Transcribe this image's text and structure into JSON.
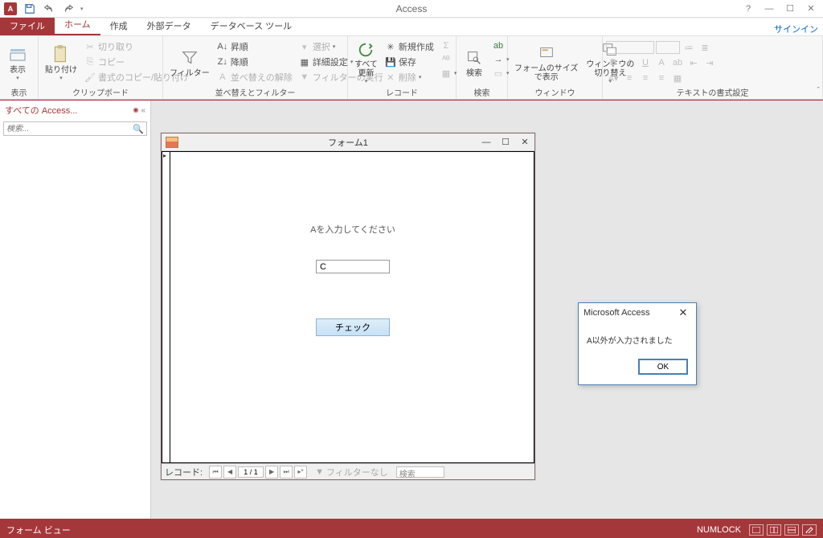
{
  "app": {
    "title": "Access",
    "signin": "サインイン"
  },
  "tabs": {
    "file": "ファイル",
    "home": "ホーム",
    "create": "作成",
    "external": "外部データ",
    "dbtools": "データベース ツール"
  },
  "ribbon": {
    "view": "表示",
    "paste": "貼り付け",
    "cut": "切り取り",
    "copy": "コピー",
    "format_painter": "書式のコピー/貼り付け",
    "clipboard_label": "クリップボード",
    "filter": "フィルター",
    "asc": "昇順",
    "desc": "降順",
    "clear_sort": "並べ替えの解除",
    "selection": "選択",
    "advanced": "詳細設定",
    "toggle_filter": "フィルターの実行",
    "sort_filter_label": "並べ替えとフィルター",
    "refresh_all": "すべて\n更新",
    "new_rec": "新規作成",
    "save_rec": "保存",
    "delete_rec": "削除",
    "records_label": "レコード",
    "find": "検索",
    "find_label": "検索",
    "fit_form": "フォームのサイズ\nで表示",
    "switch_win": "ウィンドウの\n切り替え",
    "window_label": "ウィンドウ",
    "textfmt_label": "テキストの書式設定"
  },
  "nav": {
    "title": "すべての Access...",
    "search_placeholder": "検索..."
  },
  "form": {
    "title": "フォーム1",
    "label": "Aを入力してください",
    "input_value": "C",
    "check_button": "チェック",
    "record_label": "レコード:",
    "record_pos": "1 / 1",
    "filter_none": "フィルターなし",
    "search_placeholder": "検索"
  },
  "dialog": {
    "title": "Microsoft Access",
    "message": "A以外が入力されました",
    "ok": "OK"
  },
  "status": {
    "view": "フォーム ビュー",
    "numlock": "NUMLOCK"
  }
}
